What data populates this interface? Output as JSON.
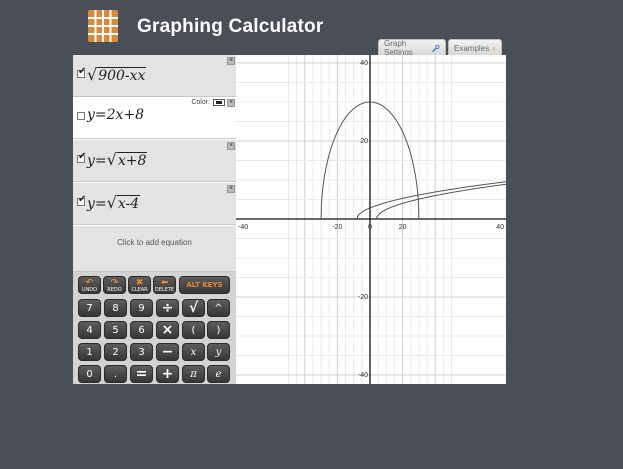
{
  "app": {
    "title": "Graphing Calculator"
  },
  "tabs": {
    "graph_settings": "Graph Settings",
    "examples": "Examples"
  },
  "equations": [
    {
      "checked": true,
      "prefix": "",
      "radicand": "900-xx",
      "plain": ""
    },
    {
      "checked": false,
      "prefix": "y=",
      "radicand": "",
      "plain": "2x+8",
      "color_label": "Color:"
    },
    {
      "checked": true,
      "prefix": "y=",
      "radicand": "x+8",
      "plain": ""
    },
    {
      "checked": true,
      "prefix": "y=",
      "radicand": "x-4",
      "plain": ""
    }
  ],
  "add_equation": "Click to add equation",
  "keypad": {
    "undo": "UNDO",
    "redo": "REDO",
    "clear": "CLEAR",
    "delete": "DELETE",
    "alt": "ALT KEYS",
    "rows": [
      [
        "7",
        "8",
        "9",
        "÷",
        "√",
        "^"
      ],
      [
        "4",
        "5",
        "6",
        "×",
        "(",
        ")"
      ],
      [
        "1",
        "2",
        "3",
        "−",
        "x",
        "y"
      ],
      [
        "0",
        ".",
        "=",
        "+",
        "π",
        "e"
      ]
    ]
  },
  "graph": {
    "x_ticks": [
      "-40",
      "-20",
      "0",
      "20",
      "40"
    ],
    "y_ticks": [
      "40",
      "20",
      "-20",
      "-40"
    ],
    "x_range": [
      -40,
      40
    ],
    "y_range": [
      -40,
      40
    ],
    "grid_step": 5,
    "curve_color": "#555555"
  }
}
